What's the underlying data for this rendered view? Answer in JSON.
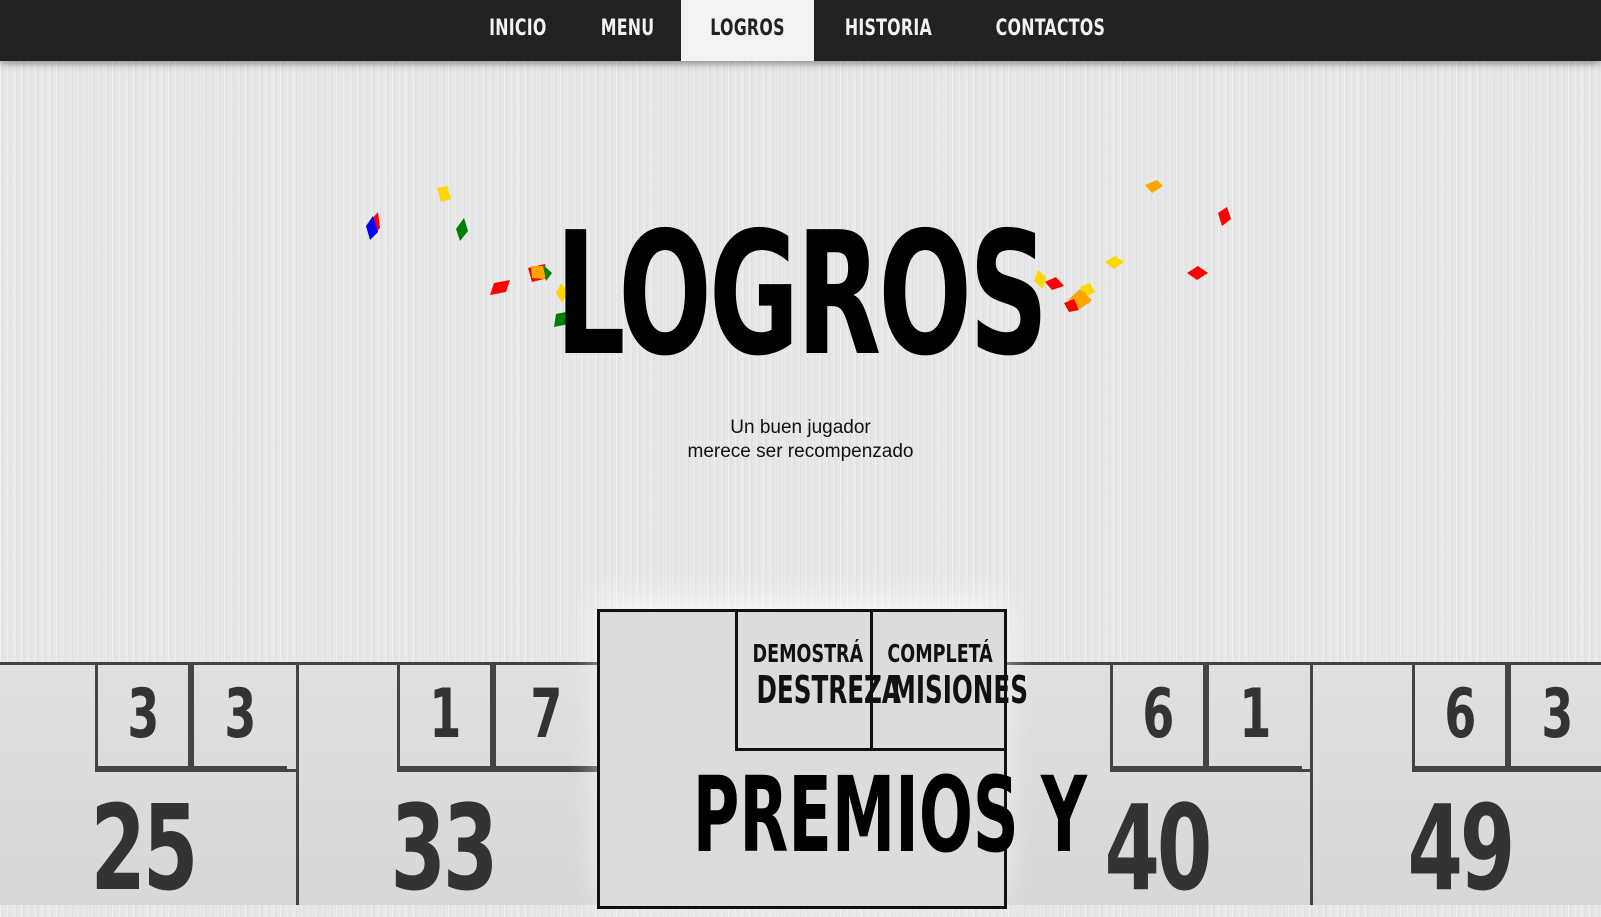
{
  "nav": {
    "items": [
      {
        "label": "INICIO",
        "active": false
      },
      {
        "label": "MENU",
        "active": false
      },
      {
        "label": "LOGROS",
        "active": true
      },
      {
        "label": "HISTORIA",
        "active": false
      },
      {
        "label": "CONTACTOS",
        "active": false
      }
    ]
  },
  "hero": {
    "title": "LOGROS",
    "subtitle_line1": "Un buen jugador",
    "subtitle_line2": "merece ser recompenzado"
  },
  "cards": [
    {
      "digits": [
        "3",
        "3"
      ],
      "number": "25"
    },
    {
      "digits": [
        "1",
        "7"
      ],
      "number": "33"
    },
    {
      "digits": [
        "6",
        "1"
      ],
      "number": "40"
    },
    {
      "digits": [
        "6",
        "3"
      ],
      "number": "49"
    }
  ],
  "feature": {
    "box1_small": "DEMOSTRÁ",
    "box1_big": "DESTREZA",
    "box2_small": "COMPLETÁ",
    "box2_big": "MISIONES",
    "title": "PREMIOS Y"
  },
  "colors": {
    "nav_bg": "#222222",
    "confetti": [
      "#ff0000",
      "#ffd700",
      "#008000",
      "#0000ff",
      "#ffa500"
    ]
  }
}
